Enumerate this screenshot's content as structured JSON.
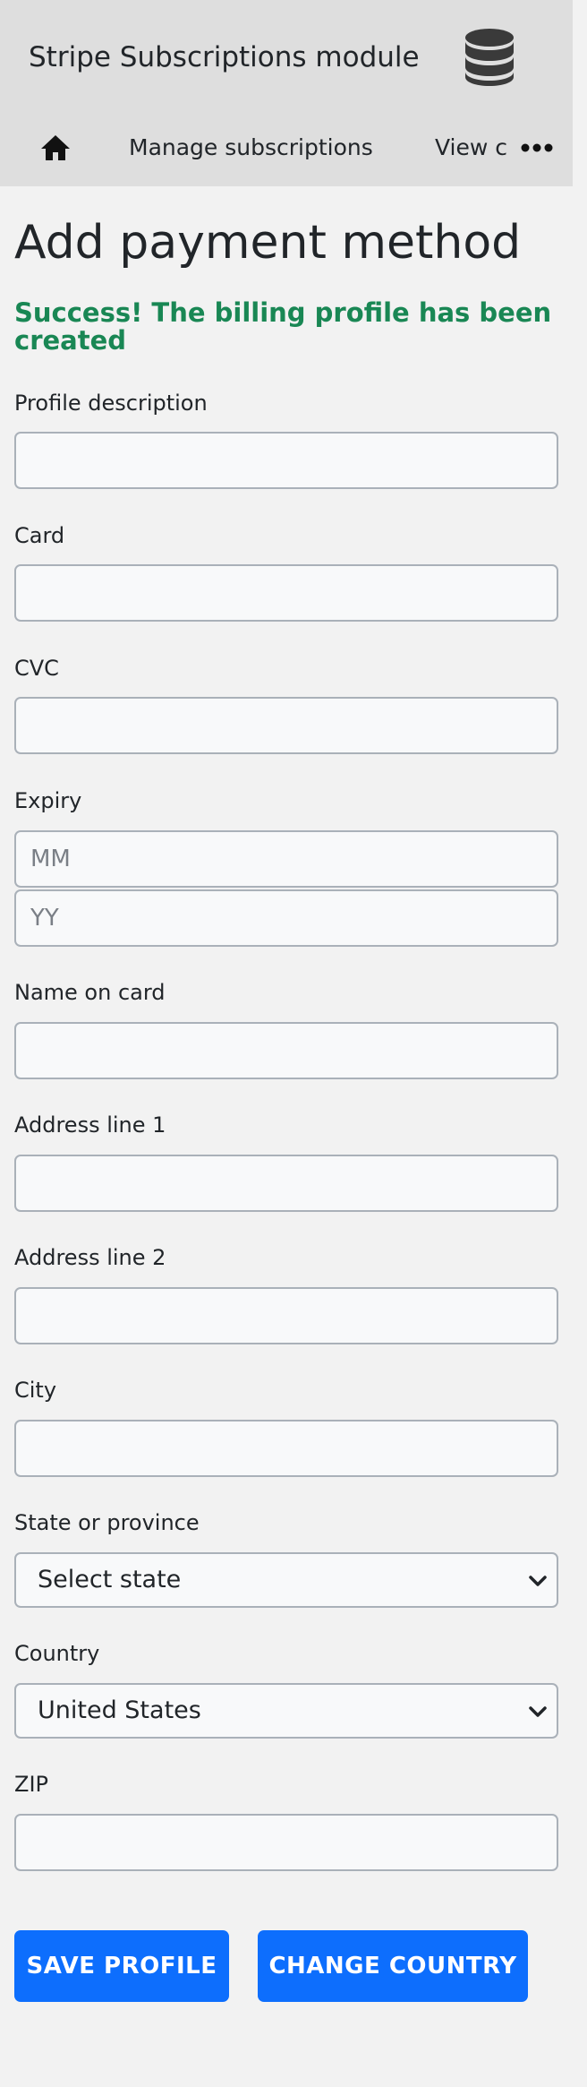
{
  "header": {
    "title": "Stripe Subscriptions module",
    "logo_icon": "database-icon"
  },
  "nav": {
    "home_icon": "home-icon",
    "items": [
      {
        "label": "Manage subscriptions"
      },
      {
        "label": "View c"
      }
    ],
    "more_icon": "more-horizontal-icon"
  },
  "main": {
    "title": "Add payment method",
    "success_message": "Success! The billing profile has been created"
  },
  "form": {
    "profile_description": {
      "label": "Profile description",
      "value": ""
    },
    "card": {
      "label": "Card",
      "value": ""
    },
    "cvc": {
      "label": "CVC",
      "value": ""
    },
    "expiry": {
      "label": "Expiry",
      "month_placeholder": "MM",
      "year_placeholder": "YY"
    },
    "name_on_card": {
      "label": "Name on card",
      "value": ""
    },
    "address_line_1": {
      "label": "Address line 1",
      "value": ""
    },
    "address_line_2": {
      "label": "Address line 2",
      "value": ""
    },
    "city": {
      "label": "City",
      "value": ""
    },
    "state": {
      "label": "State or province",
      "selected": "Select state"
    },
    "country": {
      "label": "Country",
      "selected": "United States"
    },
    "zip": {
      "label": "ZIP",
      "value": ""
    }
  },
  "actions": {
    "save_label": "SAVE PROFILE",
    "change_country_label": "CHANGE COUNTRY"
  },
  "colors": {
    "accent": "#0d6efd",
    "success": "#198754",
    "header_bg": "#dedede",
    "page_bg": "#f2f2f2"
  }
}
